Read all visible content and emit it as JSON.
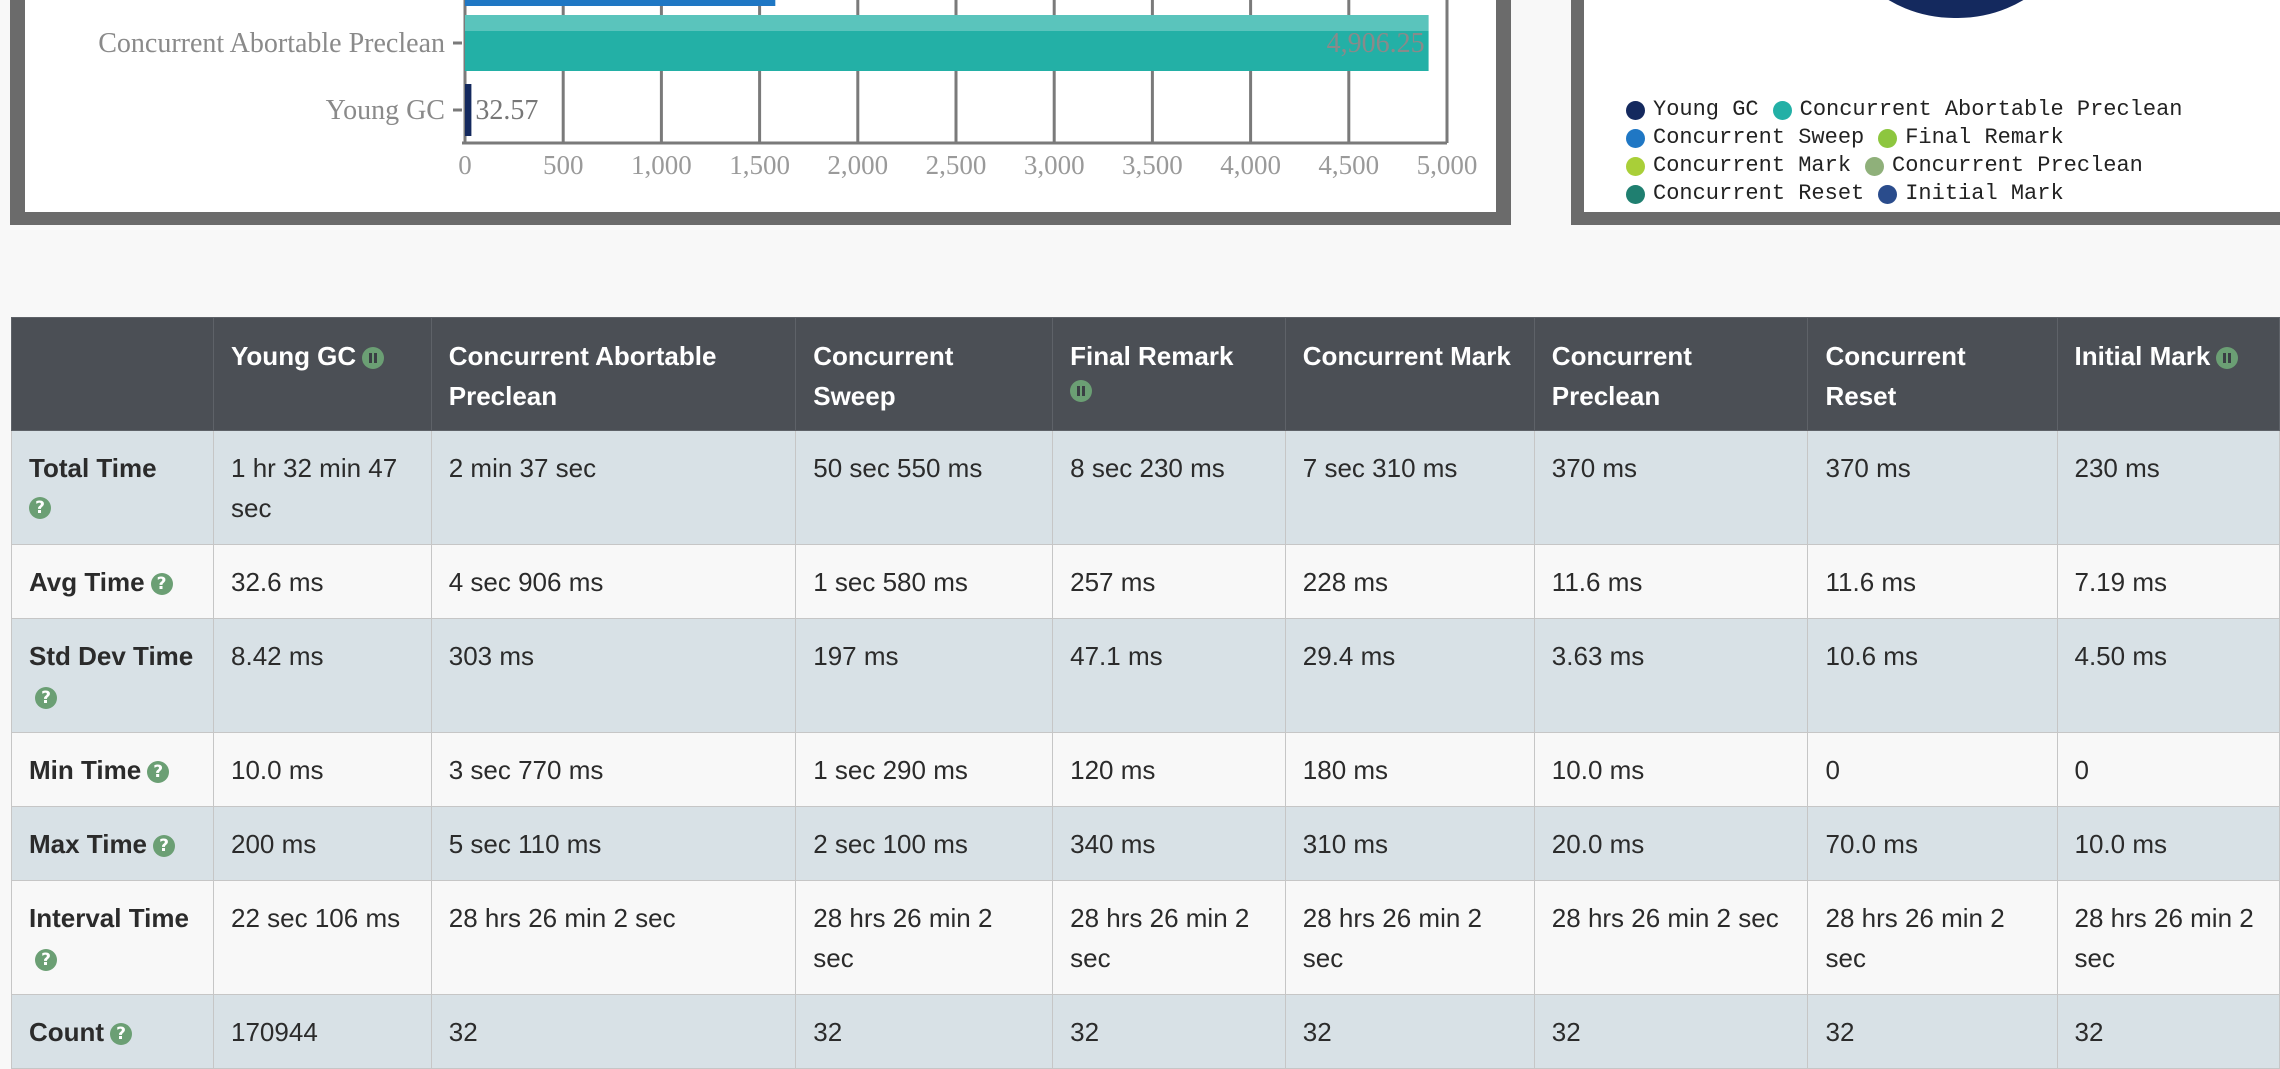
{
  "chart_data": [
    {
      "type": "bar",
      "orientation": "horizontal",
      "categories": [
        "Concurrent Sweep",
        "Concurrent Abortable Preclean",
        "Young GC"
      ],
      "visible_category_labels": [
        "Concurrent Abortable Preclean",
        "Young GC"
      ],
      "values": [
        1580,
        4906.25,
        32.57
      ],
      "data_labels": [
        "",
        "4,906.25",
        "32.57"
      ],
      "colors": [
        "#1f77c4",
        "#23b0a6",
        "#14295e"
      ],
      "xlim": [
        0,
        5000
      ],
      "xticks": [
        "0",
        "500",
        "1,000",
        "1,500",
        "2,000",
        "2,500",
        "3,000",
        "3,500",
        "4,000",
        "4,500",
        "5,000"
      ],
      "grid": "vertical"
    },
    {
      "type": "pie",
      "legend": [
        {
          "label": "Young GC",
          "color": "#14295e"
        },
        {
          "label": "Concurrent Abortable Preclean",
          "color": "#23b0a6"
        },
        {
          "label": "Concurrent Sweep",
          "color": "#1f77c4"
        },
        {
          "label": "Final Remark",
          "color": "#8dc63f"
        },
        {
          "label": "Concurrent Mark",
          "color": "#a9cf38"
        },
        {
          "label": "Concurrent Preclean",
          "color": "#8fb07a"
        },
        {
          "label": "Concurrent Reset",
          "color": "#1f7f70"
        },
        {
          "label": "Initial Mark",
          "color": "#2a4c8c"
        }
      ],
      "legend_position": "bottom"
    }
  ],
  "table": {
    "columns": [
      {
        "label": "Young GC",
        "pause": true
      },
      {
        "label": "Concurrent Abortable Preclean",
        "pause": false
      },
      {
        "label": "Concurrent Sweep",
        "pause": false
      },
      {
        "label": "Final Remark",
        "pause": true
      },
      {
        "label": "Concurrent Mark",
        "pause": false
      },
      {
        "label": "Concurrent Preclean",
        "pause": false
      },
      {
        "label": "Concurrent Reset",
        "pause": false
      },
      {
        "label": "Initial Mark",
        "pause": true
      }
    ],
    "rows": [
      {
        "label": "Total Time",
        "values": [
          "1 hr 32 min 47 sec",
          "2 min 37 sec",
          "50 sec 550 ms",
          "8 sec 230 ms",
          "7 sec 310 ms",
          "370 ms",
          "370 ms",
          "230 ms"
        ]
      },
      {
        "label": "Avg Time",
        "values": [
          "32.6 ms",
          "4 sec 906 ms",
          "1 sec 580 ms",
          "257 ms",
          "228 ms",
          "11.6 ms",
          "11.6 ms",
          "7.19 ms"
        ]
      },
      {
        "label": "Std Dev Time",
        "values": [
          "8.42 ms",
          "303 ms",
          "197 ms",
          "47.1 ms",
          "29.4 ms",
          "3.63 ms",
          "10.6 ms",
          "4.50 ms"
        ]
      },
      {
        "label": "Min Time",
        "values": [
          "10.0 ms",
          "3 sec 770 ms",
          "1 sec 290 ms",
          "120 ms",
          "180 ms",
          "10.0 ms",
          "0",
          "0"
        ]
      },
      {
        "label": "Max Time",
        "values": [
          "200 ms",
          "5 sec 110 ms",
          "2 sec 100 ms",
          "340 ms",
          "310 ms",
          "20.0 ms",
          "70.0 ms",
          "10.0 ms"
        ]
      },
      {
        "label": "Interval Time",
        "values": [
          "22 sec 106 ms",
          "28 hrs 26 min 2 sec",
          "28 hrs 26 min 2 sec",
          "28 hrs 26 min 2 sec",
          "28 hrs 26 min 2 sec",
          "28 hrs 26 min 2 sec",
          "28 hrs 26 min 2 sec",
          "28 hrs 26 min 2 sec"
        ]
      },
      {
        "label": "Count",
        "values": [
          "170944",
          "32",
          "32",
          "32",
          "32",
          "32",
          "32",
          "32"
        ]
      }
    ]
  },
  "icons": {
    "help": "help-icon",
    "pause": "pause-icon"
  }
}
